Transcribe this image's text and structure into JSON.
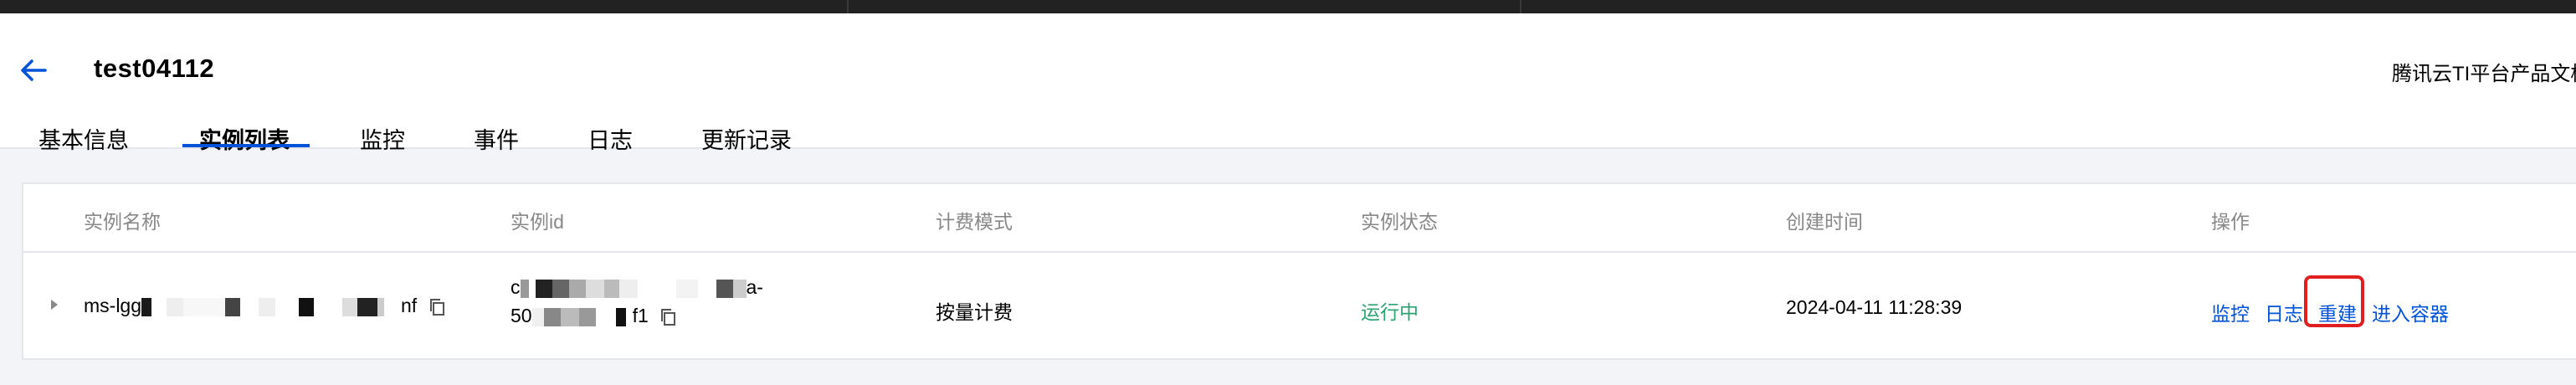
{
  "header": {
    "title": "test04112",
    "doc_link": "腾讯云TI平台产品文档"
  },
  "tabs": [
    {
      "label": "基本信息"
    },
    {
      "label": "实例列表"
    },
    {
      "label": "监控"
    },
    {
      "label": "事件"
    },
    {
      "label": "日志"
    },
    {
      "label": "更新记录"
    }
  ],
  "table": {
    "columns": [
      "实例名称",
      "实例id",
      "计费模式",
      "实例状态",
      "创建时间",
      "操作"
    ],
    "rows": [
      {
        "name_prefix": "ms-lgg",
        "name_suffix": "nf",
        "id_line1_prefix": "c",
        "id_line1_suffix": "a-",
        "id_line2_prefix": "50",
        "id_line2_suffix": "f1",
        "billing": "按量计费",
        "status": "运行中",
        "created": "2024-04-11 11:28:39",
        "actions": {
          "monitor": "监控",
          "log": "日志",
          "rebuild": "重建",
          "enter_container": "进入容器"
        }
      }
    ]
  },
  "colors": {
    "primary": "#0052d9",
    "status_running": "#2ba471",
    "highlight": "#e02020"
  }
}
